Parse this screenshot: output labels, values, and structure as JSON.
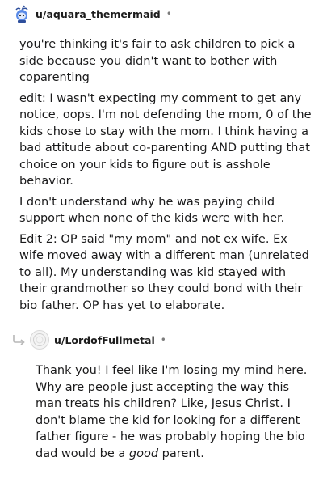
{
  "comments": [
    {
      "username": "u/aquara_themermaid",
      "separator": "•",
      "avatar_icon": "snoo-avatar-icon",
      "paragraphs": [
        "you're thinking it's fair to ask children to pick a side because you didn't want to bother with coparenting",
        "edit: I wasn't expecting my comment to get any notice, oops. I'm not defending the mom, 0 of the kids chose to stay with the mom. I think having a bad attitude about co-parenting AND putting that choice on your kids to figure out is asshole behavior.",
        "I don't understand why he was paying child support when none of the kids were with her.",
        "Edit 2: OP said \"my mom\" and not ex wife. Ex wife moved away with a different man (unrelated to all). My understanding was kid stayed with their grandmother so they could bond with their bio father. OP has yet to elaborate."
      ]
    },
    {
      "username": "u/LordofFullmetal",
      "separator": "•",
      "avatar_icon": "default-avatar-icon",
      "reply_icon": "reply-arrow-icon",
      "text_before": "Thank you! I feel like I'm losing my mind here. Why are people just accepting the way this man treats his children? Like, Jesus Christ. I don't blame the kid for looking for a different father figure - he was probably hoping the bio dad would be a ",
      "text_emphasis": "good",
      "text_after": " parent."
    }
  ],
  "colors": {
    "text": "#1a1a1b",
    "meta": "#7c7c7c",
    "snoo_blue": "#5a8be8"
  }
}
